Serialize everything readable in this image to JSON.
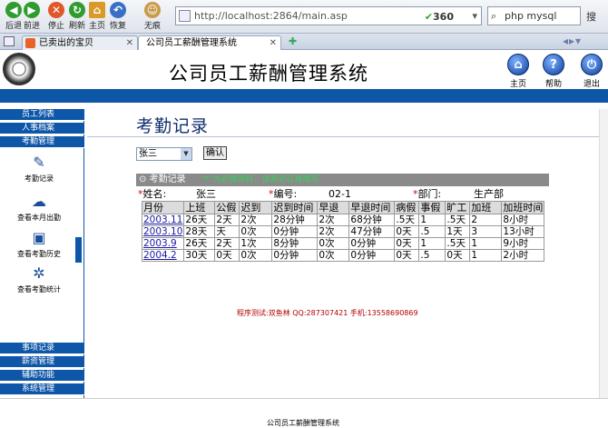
{
  "browser": {
    "buttons": [
      {
        "label": "后退",
        "icon": "back-arrow-icon",
        "color": "#2f9c2f"
      },
      {
        "label": "前进",
        "icon": "forward-arrow-icon",
        "color": "#2f9c2f"
      },
      {
        "label": "停止",
        "icon": "stop-icon",
        "color": "#e0572a"
      },
      {
        "label": "刷新",
        "icon": "refresh-icon",
        "color": "#2f9c2f"
      },
      {
        "label": "主页",
        "icon": "home-icon",
        "color": "#d89b2a"
      },
      {
        "label": "恢复",
        "icon": "undo-icon",
        "color": "#3b6fc4"
      },
      {
        "label": "无痕",
        "icon": "incognito-icon",
        "color": "#c89b4a"
      }
    ],
    "url": "http://localhost:2864/main.asp",
    "badge": "360",
    "search_value": "php mysql",
    "tabs": [
      {
        "label": "已卖出的宝贝"
      },
      {
        "label": "公司员工薪酬管理系统"
      }
    ]
  },
  "header": {
    "title": "公司员工薪酬管理系统",
    "buttons": [
      {
        "label": "主页",
        "glyph": "⌂"
      },
      {
        "label": "帮助",
        "glyph": "?"
      },
      {
        "label": "退出",
        "glyph": "⏻"
      }
    ]
  },
  "sidebar": {
    "top_items": [
      "员工列表",
      "人事档案",
      "考勤管理"
    ],
    "icons": [
      {
        "label": "考勤记录",
        "glyph": "✎"
      },
      {
        "label": "查看本月出勤",
        "glyph": "☁"
      },
      {
        "label": "查看考勤历史",
        "glyph": "▣"
      },
      {
        "label": "查看考勤统计",
        "glyph": "✲"
      }
    ],
    "bottom_items": [
      "事项记录",
      "薪资管理",
      "辅助功能",
      "系统管理"
    ]
  },
  "main": {
    "page_title": "考勤记录",
    "select_value": "张三",
    "confirm_label": "确认",
    "record_title": "考勤记录",
    "record_hint": "\"*\"为必填资料，请务必认真填写",
    "name_label": "姓名:",
    "name_value": "张三",
    "id_label": "编号:",
    "id_value": "02-1",
    "dept_label": "部门:",
    "dept_value": "生产部",
    "columns": [
      "月份",
      "上班",
      "公假",
      "迟到",
      "迟到时间",
      "早退",
      "早退时间",
      "病假",
      "事假",
      "旷工",
      "加班",
      "加班时间"
    ],
    "rows": [
      [
        "2003.11",
        "26天",
        "2天",
        "2次",
        "28分钟",
        "2次",
        "68分钟",
        ".5天",
        "1",
        ".5天",
        "2",
        "8小时"
      ],
      [
        "2003.10",
        "28天",
        "天",
        "0次",
        "0分钟",
        "2次",
        "47分钟",
        "0天",
        ".5",
        "1天",
        "3",
        "13小时"
      ],
      [
        "2003.9",
        "26天",
        "2天",
        "1次",
        "8分钟",
        "0次",
        "0分钟",
        "0天",
        "1",
        ".5天",
        "1",
        "9小时"
      ],
      [
        "2004.2",
        "30天",
        "0天",
        "0次",
        "0分钟",
        "0次",
        "0分钟",
        "0天",
        ".5",
        "0天",
        "1",
        "2小时"
      ]
    ],
    "credit": "程序测试:双鱼林 QQ:287307421 手机:13558690869"
  },
  "footer": "公司员工薪酬管理系统",
  "colors": {
    "nav_blue": "#0d56a8",
    "title_navy": "#0f2e6d",
    "hint_green": "#35d35a",
    "credit_red": "#b30000"
  }
}
